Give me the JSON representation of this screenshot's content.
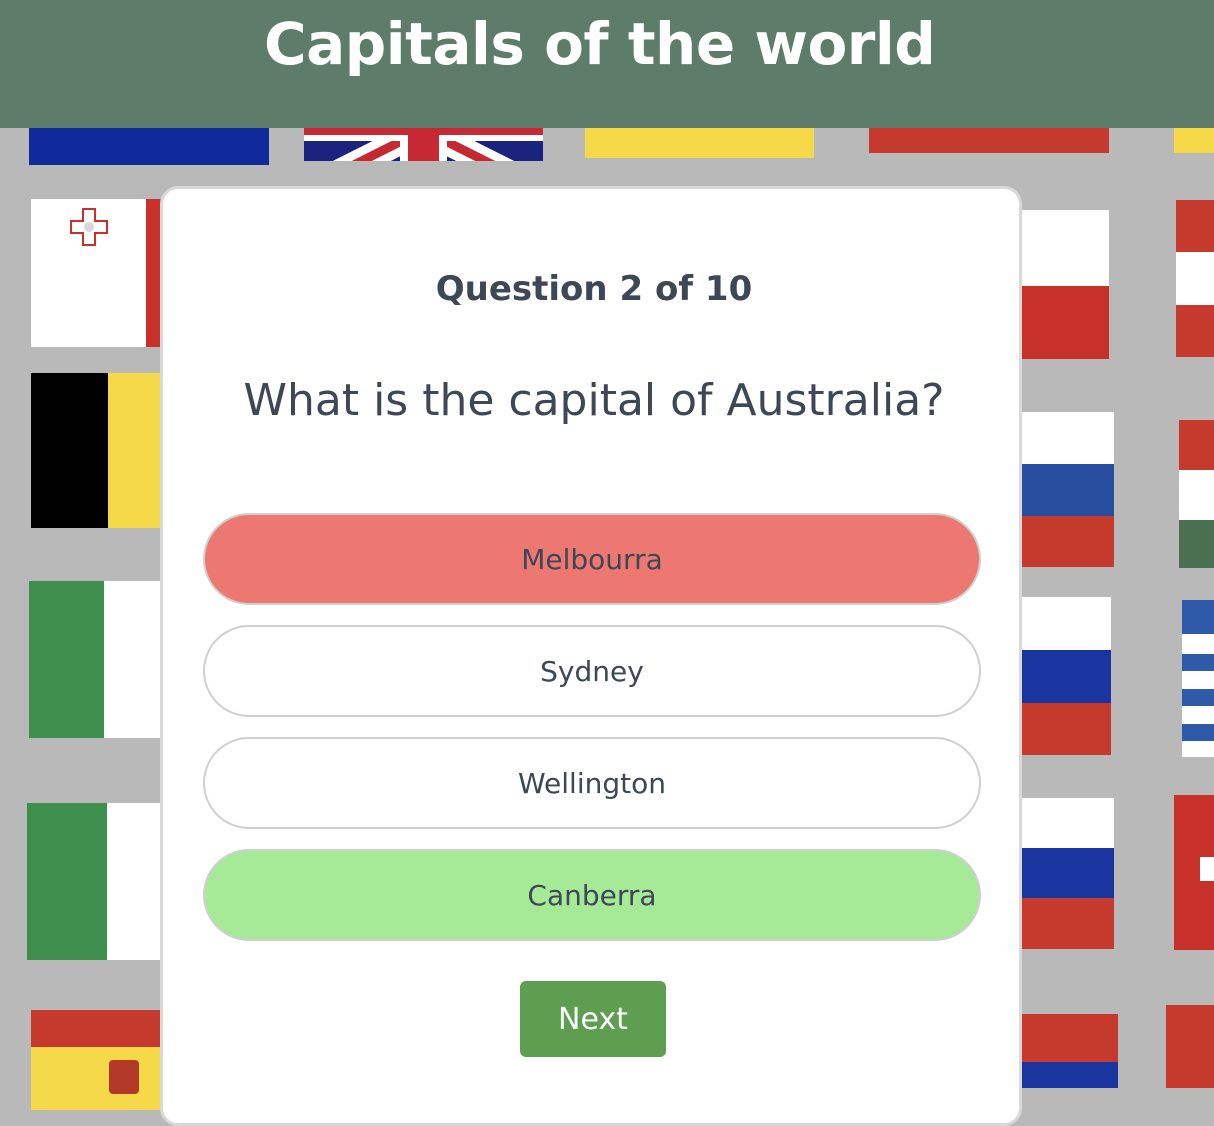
{
  "header": {
    "title": "Capitals of the world"
  },
  "quiz": {
    "counter": "Question 2 of 10",
    "question": "What is the capital of Australia?",
    "answers": [
      {
        "label": "Melbourra",
        "state": "wrong"
      },
      {
        "label": "Sydney",
        "state": "neutral"
      },
      {
        "label": "Wellington",
        "state": "neutral"
      },
      {
        "label": "Canberra",
        "state": "correct"
      }
    ],
    "next_label": "Next"
  },
  "colors": {
    "header_bg": "#5e7c6a",
    "wrong": "#ed7872",
    "correct": "#a6ea98",
    "next_button": "#5d9e51",
    "text": "#3d4756",
    "background": "#b9b9b9"
  },
  "background_flags": [
    "eu",
    "united-kingdom",
    "ukraine",
    "latvia",
    "malta",
    "belgium",
    "italy",
    "ireland",
    "spain",
    "poland",
    "austria",
    "russia",
    "slovenia",
    "greece",
    "switzerland"
  ]
}
